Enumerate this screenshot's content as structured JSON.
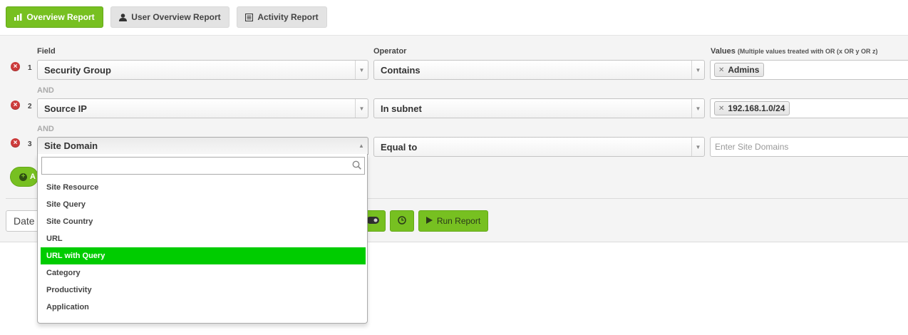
{
  "tabs": [
    {
      "label": "Overview Report",
      "icon": "bar-chart-icon",
      "active": true
    },
    {
      "label": "User Overview Report",
      "icon": "user-icon",
      "active": false
    },
    {
      "label": "Activity Report",
      "icon": "list-icon",
      "active": false
    }
  ],
  "columns": {
    "field": "Field",
    "operator": "Operator",
    "values": "Values",
    "values_hint": "(Multiple values treated with OR (x OR y OR z)"
  },
  "rows": [
    {
      "num": "1",
      "field": "Security Group",
      "operator": "Contains",
      "value": "Admins"
    },
    {
      "num": "2",
      "field": "Source IP",
      "operator": "In subnet",
      "value": "192.168.1.0/24"
    },
    {
      "num": "3",
      "field": "Site Domain",
      "operator": "Equal to",
      "placeholder": "Enter Site Domains"
    }
  ],
  "connector": "AND",
  "add_button": {
    "label": "A"
  },
  "date_label": "Date",
  "run_report_label": "Run Report",
  "dropdown": {
    "search_value": "",
    "options": [
      "Site Resource",
      "Site Query",
      "Site Country",
      "URL",
      "URL with Query",
      "Category",
      "Productivity",
      "Application"
    ],
    "highlighted": "URL with Query"
  },
  "colors": {
    "accent": "#77c021",
    "highlight": "#00cc00",
    "remove": "#cc3b3b"
  }
}
